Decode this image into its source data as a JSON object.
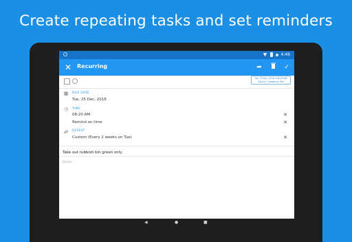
{
  "headline": "Create repeating tasks and set reminders",
  "status_bar": {
    "time": "4:49"
  },
  "app_bar": {
    "title": "Recurring",
    "close_icon": "close-icon",
    "action_icons": [
      "share-icon",
      "delete-icon",
      "check-icon"
    ]
  },
  "schedule_chip": {
    "line1": "Tue, 25 Dec, 2018 C08:20 AM",
    "line2": "&Every 2 weeks on Tue"
  },
  "due_date": {
    "label": "DUE DATE",
    "value": "Tue, 25 Dec, 2018"
  },
  "time": {
    "label": "TIME",
    "value": "08:20 AM",
    "remind": "Remind on time"
  },
  "repeat": {
    "label": "REPEAT",
    "value": "Custom (Every 2 weeks on Tue)"
  },
  "task": {
    "text": "Take out rubbish bin green only",
    "notes_placeholder": "Notes"
  },
  "colors": {
    "background": "#1a8fe3",
    "app_bar": "#2196f3",
    "status_bar": "#1673c8",
    "accent": "#2196f3"
  }
}
